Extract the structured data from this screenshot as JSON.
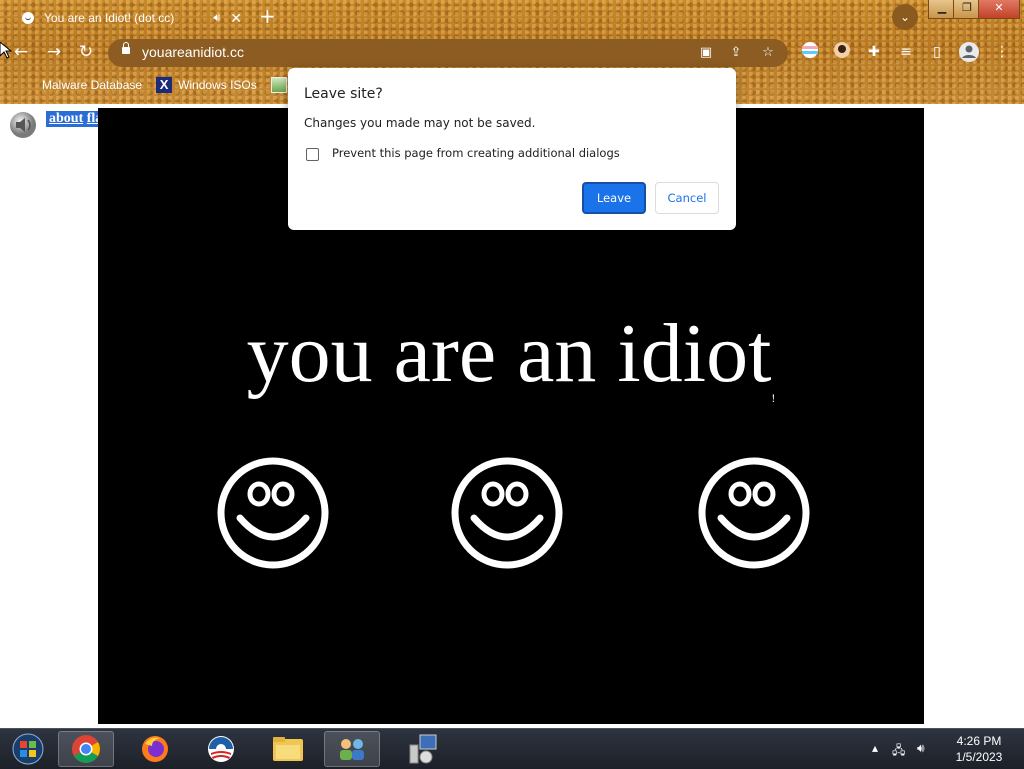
{
  "browser": {
    "tab": {
      "title": "You are an Idiot! (dot cc)",
      "audio_icon": "speaker-icon",
      "close_label": "✕"
    },
    "new_tab_label": "+",
    "tab_search_label": "⌄",
    "window_controls": {
      "minimize": "▁",
      "restore": "❐",
      "close": "✕"
    },
    "url": "youareanidiot.cc",
    "bookmarks": [
      {
        "label": "Malware Database",
        "icon": "malware-icon"
      },
      {
        "label": "Windows ISOs",
        "icon": "x-logo-icon"
      },
      {
        "label": "",
        "icon": "image-icon"
      }
    ]
  },
  "page": {
    "links": {
      "about": "about",
      "flash": "flash"
    },
    "headline": "you are an idiot",
    "headline_suffix": "!",
    "smiley_count": 3
  },
  "dialog": {
    "title": "Leave site?",
    "message": "Changes you made may not be saved.",
    "checkbox_label": "Prevent this page from creating additional dialogs",
    "checkbox_checked": false,
    "leave_label": "Leave",
    "cancel_label": "Cancel"
  },
  "taskbar": {
    "apps": [
      "start-orb",
      "chrome",
      "firefox",
      "obama-logo",
      "file-explorer",
      "network-app",
      "installer-app"
    ],
    "time": "4:26 PM",
    "date": "1/5/2023"
  },
  "colors": {
    "accent": "#1a73e8",
    "chrome_bg": "#b87822",
    "taskbar": "#1c2028"
  }
}
